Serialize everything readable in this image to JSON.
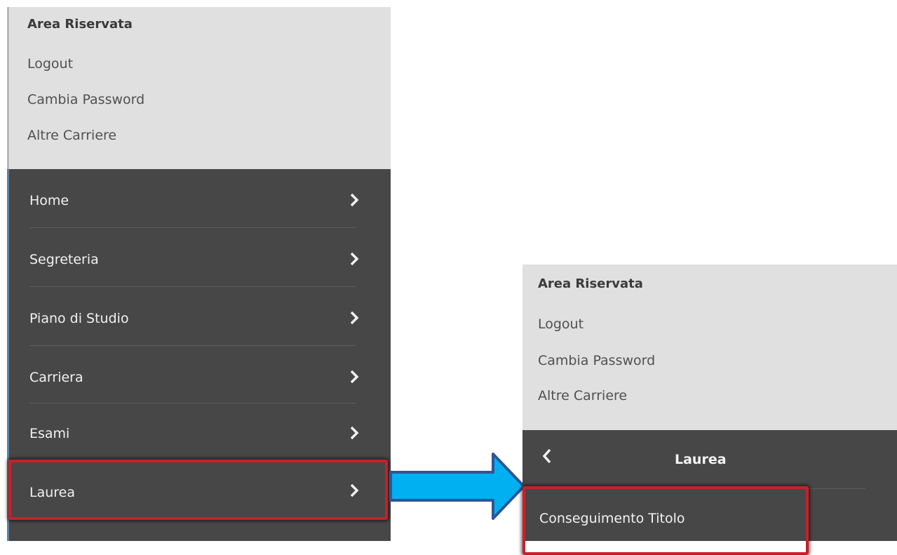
{
  "left_panel": {
    "section_title": "Area Riservata",
    "links": [
      "Logout",
      "Cambia Password",
      "Altre Carriere"
    ],
    "menu_items": [
      "Home",
      "Segreteria",
      "Piano di Studio",
      "Carriera",
      "Esami",
      "Laurea"
    ]
  },
  "right_panel": {
    "section_title": "Area Riservata",
    "links": [
      "Logout",
      "Cambia Password",
      "Altre Carriere"
    ],
    "submenu_title": "Laurea",
    "submenu_items": [
      "Conseguimento Titolo"
    ]
  },
  "colors": {
    "header_bg": "#e0e0e0",
    "menu_bg": "#474747",
    "highlight_border": "#c8202a",
    "arrow_fill": "#00b0f0",
    "arrow_stroke": "#2f5597"
  },
  "icons": [
    "chevron-right-icon",
    "chevron-left-icon",
    "arrow-right-icon"
  ]
}
